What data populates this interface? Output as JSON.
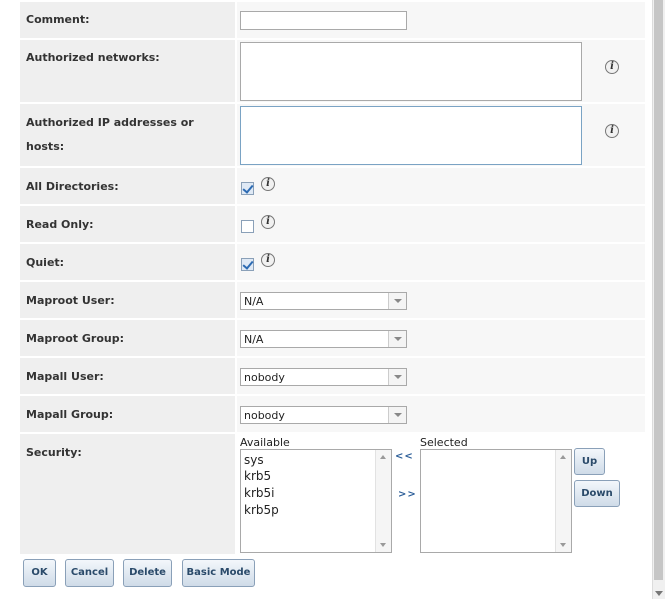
{
  "form": {
    "comment": {
      "label": "Comment:",
      "value": ""
    },
    "authorized_networks": {
      "label": "Authorized networks:",
      "value": ""
    },
    "authorized_hosts": {
      "label": "Authorized IP addresses or",
      "label2": "hosts:",
      "value": ""
    },
    "all_directories": {
      "label": "All Directories:",
      "checked": true
    },
    "read_only": {
      "label": "Read Only:",
      "checked": false
    },
    "quiet": {
      "label": "Quiet:",
      "checked": true
    },
    "maproot_user": {
      "label": "Maproot User:",
      "value": "N/A"
    },
    "maproot_group": {
      "label": "Maproot Group:",
      "value": "N/A"
    },
    "mapall_user": {
      "label": "Mapall User:",
      "value": "nobody"
    },
    "mapall_group": {
      "label": "Mapall Group:",
      "value": "nobody"
    },
    "security": {
      "label": "Security:",
      "available_label": "Available",
      "selected_label": "Selected",
      "available": [
        "sys",
        "krb5",
        "krb5i",
        "krb5p"
      ],
      "selected": [],
      "move_left": "<<",
      "move_right": ">>",
      "up": "Up",
      "down": "Down"
    },
    "info_icon": "i"
  },
  "buttons": {
    "ok": "OK",
    "cancel": "Cancel",
    "delete": "Delete",
    "basic_mode": "Basic Mode"
  }
}
